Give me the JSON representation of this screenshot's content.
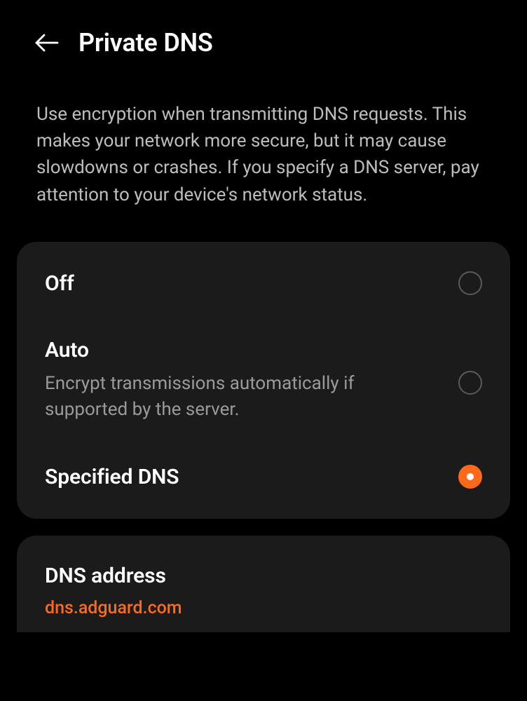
{
  "header": {
    "title": "Private DNS"
  },
  "description": "Use encryption when transmitting DNS requests. This makes your network more secure, but it may cause slowdowns or crashes. If you specify a DNS server, pay attention to your device's network status.",
  "options": {
    "off": {
      "title": "Off"
    },
    "auto": {
      "title": "Auto",
      "subtitle": "Encrypt transmissions automatically if supported by the server."
    },
    "specified": {
      "title": "Specified DNS"
    }
  },
  "dns_field": {
    "label": "DNS address",
    "value": "dns.adguard.com"
  },
  "colors": {
    "accent": "#ff6a1a"
  }
}
